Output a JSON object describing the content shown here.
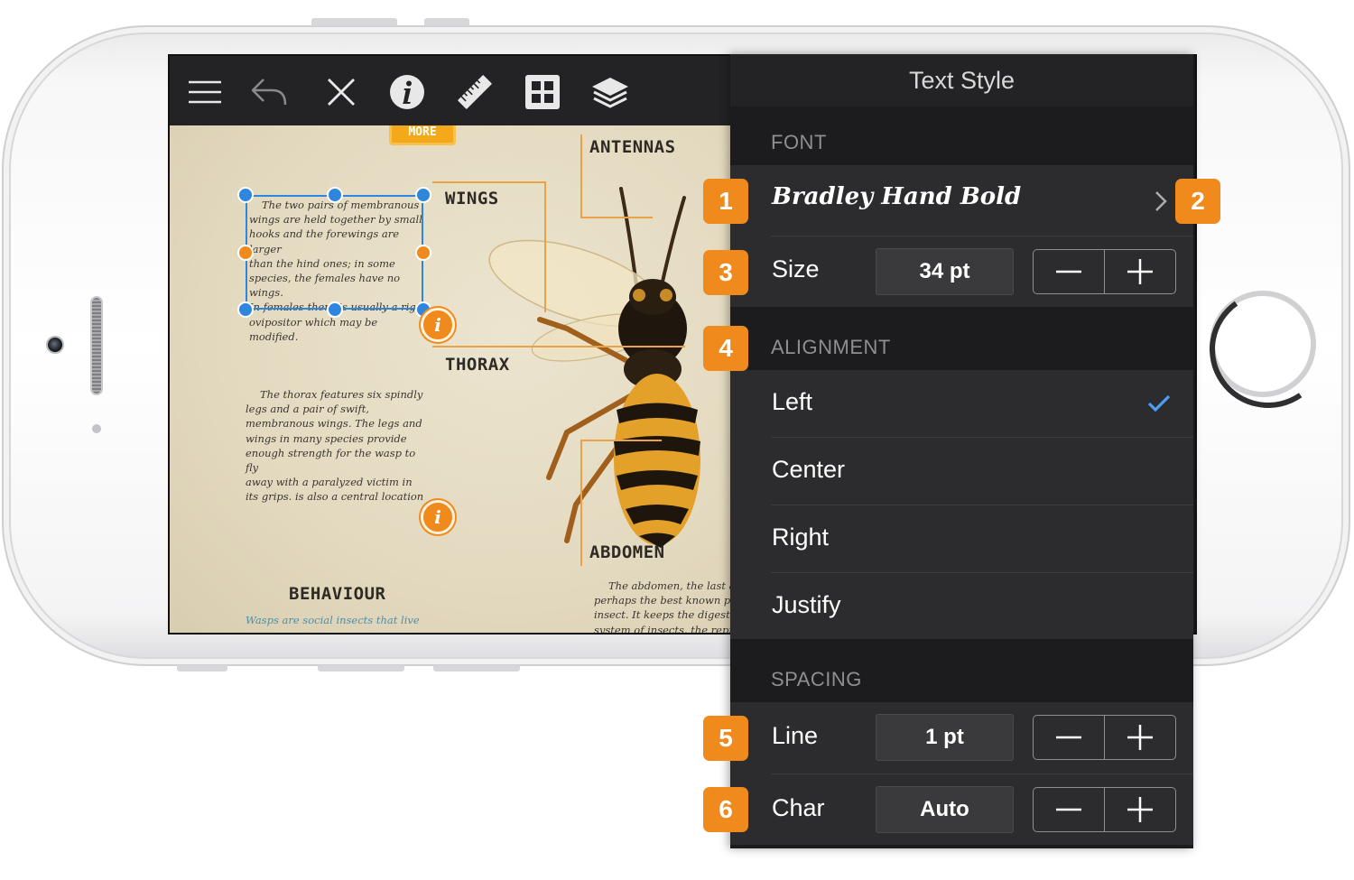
{
  "panel": {
    "title": "Text Style",
    "font_section": "FONT",
    "font_name": "Bradley Hand Bold",
    "size_label": "Size",
    "size_value": "34 pt",
    "alignment_section": "ALIGNMENT",
    "alignment_options": [
      "Left",
      "Center",
      "Right",
      "Justify"
    ],
    "alignment_selected": "Left",
    "spacing_section": "SPACING",
    "line_label": "Line",
    "line_value": "1 pt",
    "char_label": "Char",
    "char_value": "Auto"
  },
  "callouts": [
    "1",
    "2",
    "3",
    "4",
    "5",
    "6"
  ],
  "toolbar": {
    "icons": [
      "menu-icon",
      "undo-icon",
      "close-icon",
      "info-icon",
      "ruler-icon",
      "media-icon",
      "layers-icon"
    ]
  },
  "canvas": {
    "more_label": "MORE",
    "wings_label": "WINGS",
    "antennas_label": "ANTENNAS",
    "thorax_label": "THORAX",
    "abdomen_label": "ABDOMEN",
    "behaviour_label": "BEHAVIOUR",
    "wings_text": [
      "The two pairs of membranous",
      "wings are held together by small",
      "hooks and the forewings are larger",
      "than the hind ones; in some",
      "species, the females have no wings.",
      "In females there is usually a rigid",
      "ovipositor which may be modified."
    ],
    "thorax_text": [
      "The thorax features six spindly",
      "legs and a pair of swift,",
      "membranous wings. The legs and",
      "wings in many species provide",
      "enough strength for the wasp to fly",
      "away with a paralyzed victim in",
      "its grips. is also a central location"
    ],
    "abdomen_text": [
      "The abdomen, the last an",
      "perhaps the best known part",
      "insect. It keeps the digestive",
      "system of insects, the repro"
    ],
    "behaviour_text": "Wasps are social insects that live"
  },
  "colors": {
    "accent_orange": "#f08a1d",
    "selection_blue": "#2e86de",
    "checkmark_blue": "#4a9ff5",
    "panel_bg": "#2c2c2e"
  }
}
